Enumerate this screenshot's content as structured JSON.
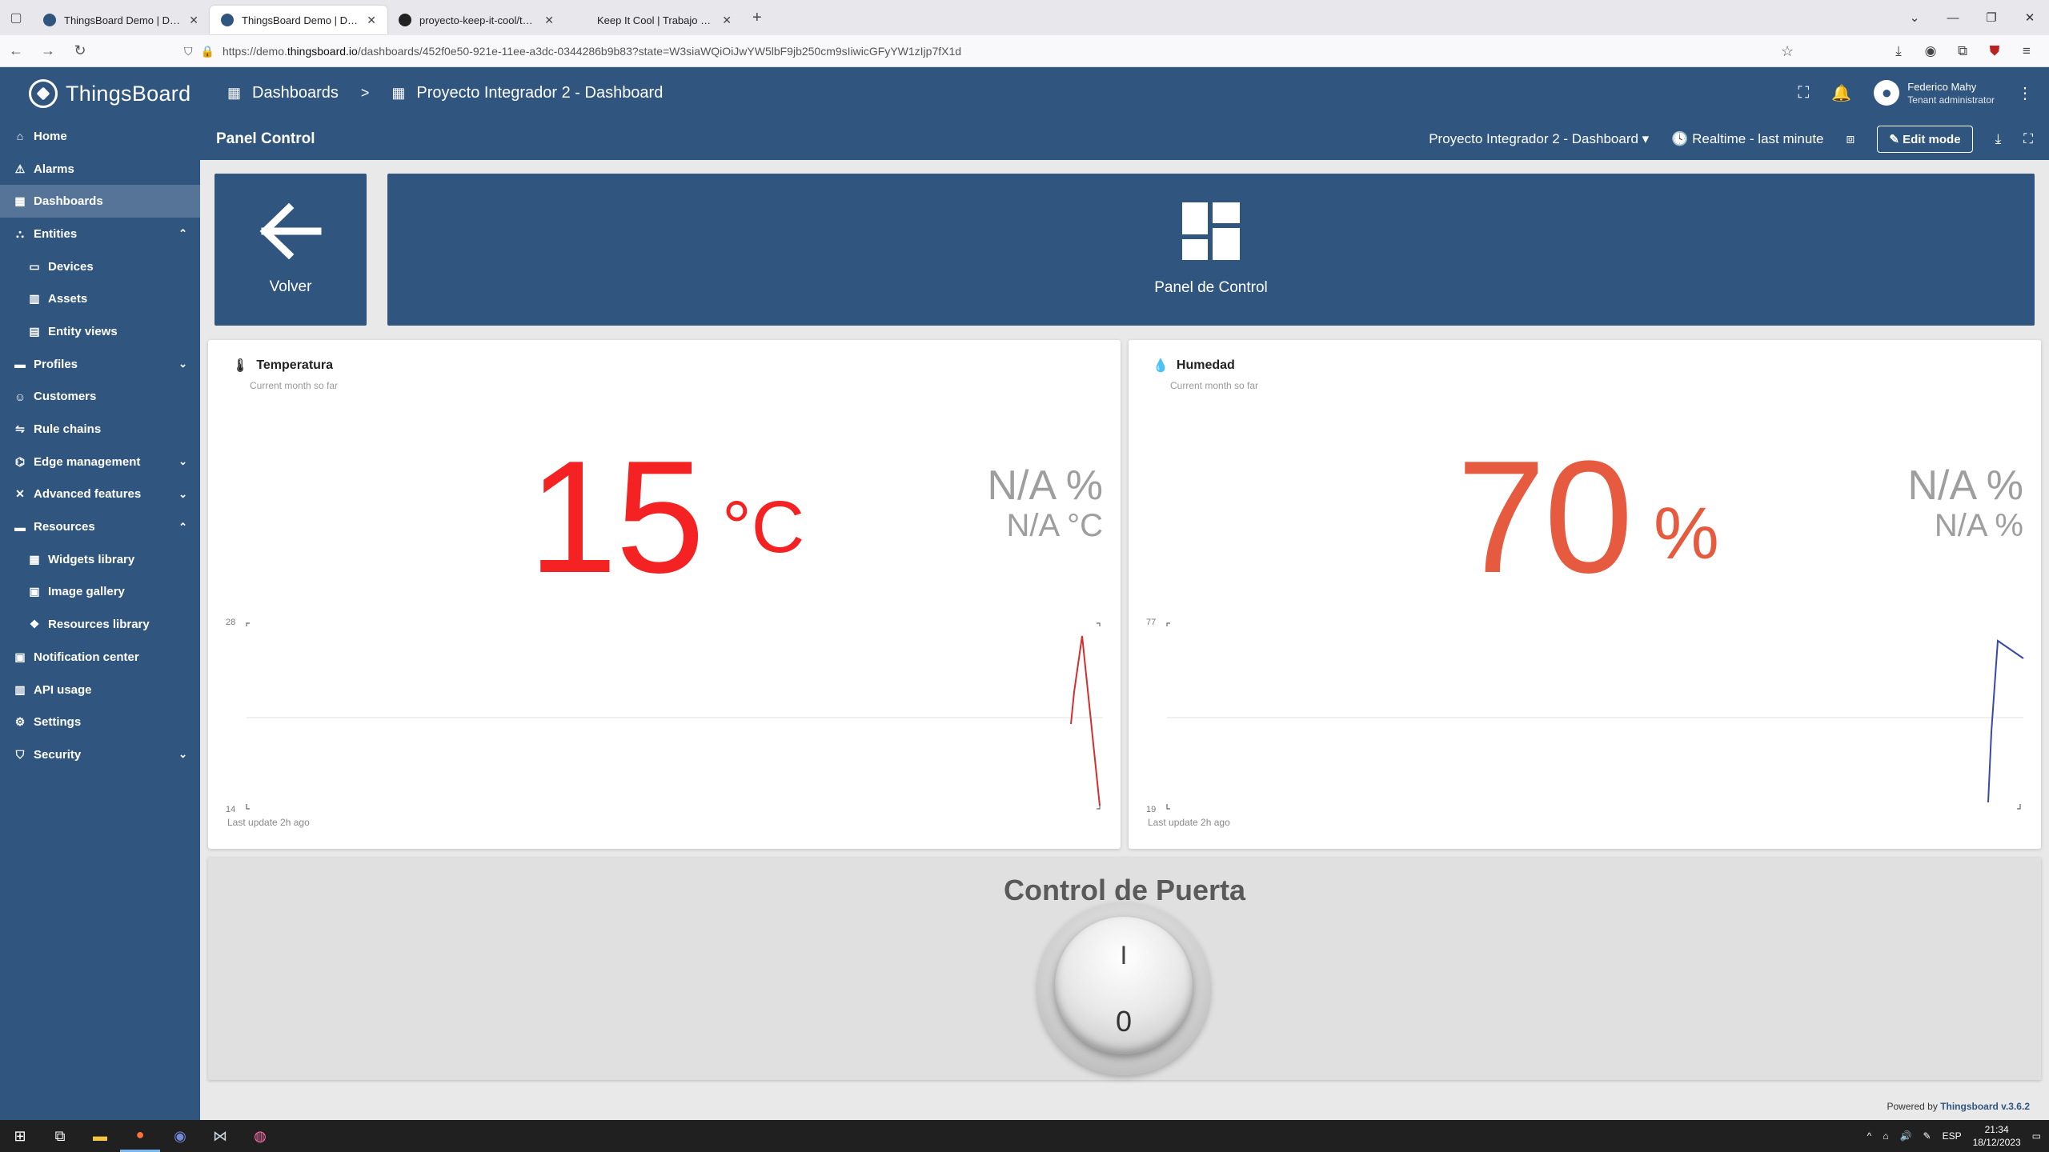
{
  "browser": {
    "tabs": [
      {
        "title": "ThingsBoard Demo | Dashboard",
        "active": false,
        "favicon": "thingsboard"
      },
      {
        "title": "ThingsBoard Demo | Dashboard",
        "active": true,
        "favicon": "thingsboard"
      },
      {
        "title": "proyecto-keep-it-cool/thingsb",
        "active": false,
        "favicon": "github"
      },
      {
        "title": "Keep It Cool | Trabajo realizado en e",
        "active": false,
        "favicon": "none"
      }
    ],
    "url_prefix": "https://demo.",
    "url_host": "thingsboard.io",
    "url_path": "/dashboards/452f0e50-921e-11ee-a3dc-0344286b9b83?state=W3siaWQiOiJwYW5lbF9jb250cm9sIiwicGFyYW1zIjp7fX1d"
  },
  "sidebar": {
    "brand": "ThingsBoard",
    "items": [
      {
        "label": "Home",
        "icon": "home-icon",
        "sub": false,
        "active": false
      },
      {
        "label": "Alarms",
        "icon": "warning-icon",
        "sub": false,
        "active": false
      },
      {
        "label": "Dashboards",
        "icon": "dashboard-icon",
        "sub": false,
        "active": true
      },
      {
        "label": "Entities",
        "icon": "entities-icon",
        "sub": false,
        "active": false,
        "chevron": "up"
      },
      {
        "label": "Devices",
        "icon": "device-icon",
        "sub": true,
        "active": false
      },
      {
        "label": "Assets",
        "icon": "asset-icon",
        "sub": true,
        "active": false
      },
      {
        "label": "Entity views",
        "icon": "entity-view-icon",
        "sub": true,
        "active": false
      },
      {
        "label": "Profiles",
        "icon": "folder-icon",
        "sub": false,
        "active": false,
        "chevron": "down"
      },
      {
        "label": "Customers",
        "icon": "customers-icon",
        "sub": false,
        "active": false
      },
      {
        "label": "Rule chains",
        "icon": "rule-chain-icon",
        "sub": false,
        "active": false
      },
      {
        "label": "Edge management",
        "icon": "edge-icon",
        "sub": false,
        "active": false,
        "chevron": "down"
      },
      {
        "label": "Advanced features",
        "icon": "tools-icon",
        "sub": false,
        "active": false,
        "chevron": "down"
      },
      {
        "label": "Resources",
        "icon": "folder-icon",
        "sub": false,
        "active": false,
        "chevron": "up"
      },
      {
        "label": "Widgets library",
        "icon": "widgets-icon",
        "sub": true,
        "active": false
      },
      {
        "label": "Image gallery",
        "icon": "image-icon",
        "sub": true,
        "active": false
      },
      {
        "label": "Resources library",
        "icon": "resources-icon",
        "sub": true,
        "active": false
      },
      {
        "label": "Notification center",
        "icon": "notification-icon",
        "sub": false,
        "active": false
      },
      {
        "label": "API usage",
        "icon": "chart-icon",
        "sub": false,
        "active": false
      },
      {
        "label": "Settings",
        "icon": "gear-icon",
        "sub": false,
        "active": false
      },
      {
        "label": "Security",
        "icon": "shield-icon",
        "sub": false,
        "active": false,
        "chevron": "down"
      }
    ]
  },
  "header": {
    "breadcrumb_root": "Dashboards",
    "breadcrumb_sep": ">",
    "breadcrumb_current": "Proyecto Integrador 2 - Dashboard",
    "user_name": "Federico Mahy",
    "user_role": "Tenant administrator"
  },
  "subheader": {
    "title": "Panel Control",
    "dashboard_select": "Proyecto Integrador 2 - Dashboard",
    "timewindow": "Realtime - last minute",
    "edit_mode": "Edit mode"
  },
  "tiles": {
    "back_label": "Volver",
    "panel_label": "Panel de Control"
  },
  "temperature": {
    "title": "Temperatura",
    "subtitle": "Current month so far",
    "value": "15",
    "unit": "°C",
    "na_primary": "N/A %",
    "na_secondary": "N/A °C",
    "axis_max": "28",
    "axis_min": "14",
    "last_update": "Last update 2h ago",
    "color": "#f42222"
  },
  "humidity": {
    "title": "Humedad",
    "subtitle": "Current month so far",
    "value": "70",
    "unit": "%",
    "na_primary": "N/A %",
    "na_secondary": "N/A %",
    "axis_max": "77",
    "axis_min": "19",
    "last_update": "Last update 2h ago",
    "color": "#e65a3f"
  },
  "door": {
    "title": "Control de Puerta",
    "on_label": "I",
    "off_label": "0"
  },
  "footer": {
    "powered_by": "Powered by",
    "version_link": "Thingsboard v.3.6.2"
  },
  "taskbar": {
    "lang": "ESP",
    "time": "21:34",
    "date": "18/12/2023"
  }
}
